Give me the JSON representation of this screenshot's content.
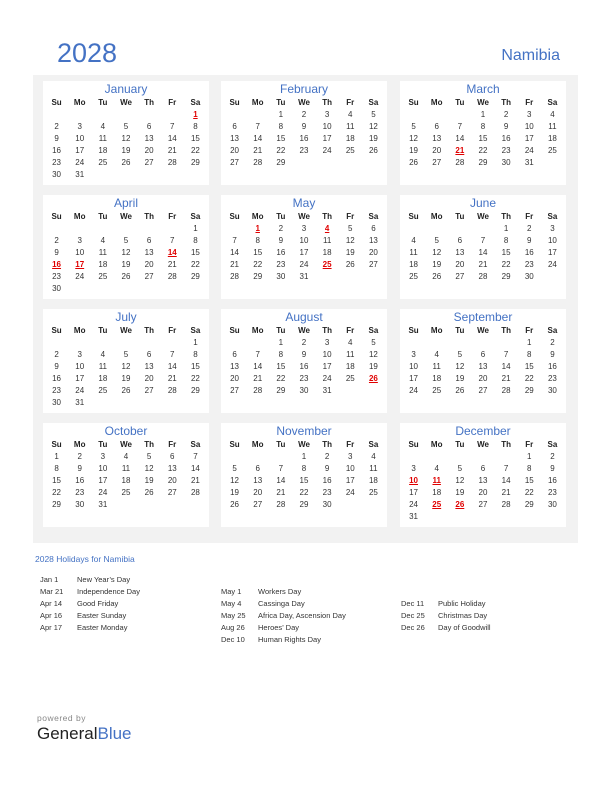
{
  "header": {
    "year": "2028",
    "country": "Namibia"
  },
  "weekdays": [
    "Su",
    "Mo",
    "Tu",
    "We",
    "Th",
    "Fr",
    "Sa"
  ],
  "months": [
    {
      "name": "January",
      "offset": 6,
      "days": 31,
      "holidays": [
        1
      ]
    },
    {
      "name": "February",
      "offset": 2,
      "days": 29,
      "holidays": []
    },
    {
      "name": "March",
      "offset": 3,
      "days": 31,
      "holidays": [
        21
      ]
    },
    {
      "name": "April",
      "offset": 6,
      "days": 30,
      "holidays": [
        14,
        16,
        17
      ]
    },
    {
      "name": "May",
      "offset": 1,
      "days": 31,
      "holidays": [
        1,
        4,
        25
      ]
    },
    {
      "name": "June",
      "offset": 4,
      "days": 30,
      "holidays": []
    },
    {
      "name": "July",
      "offset": 6,
      "days": 31,
      "holidays": []
    },
    {
      "name": "August",
      "offset": 2,
      "days": 31,
      "holidays": [
        26
      ]
    },
    {
      "name": "September",
      "offset": 5,
      "days": 30,
      "holidays": []
    },
    {
      "name": "October",
      "offset": 0,
      "days": 31,
      "holidays": []
    },
    {
      "name": "November",
      "offset": 3,
      "days": 30,
      "holidays": []
    },
    {
      "name": "December",
      "offset": 5,
      "days": 31,
      "holidays": [
        10,
        11,
        25,
        26
      ]
    }
  ],
  "holidays_title": "2028 Holidays for Namibia",
  "holiday_columns": [
    [
      {
        "date": "Jan 1",
        "name": "New Year’s Day"
      },
      {
        "date": "Mar 21",
        "name": "Independence Day"
      },
      {
        "date": "Apr 14",
        "name": "Good Friday"
      },
      {
        "date": "Apr 16",
        "name": "Easter Sunday"
      },
      {
        "date": "Apr 17",
        "name": "Easter Monday"
      }
    ],
    [
      {
        "date": "May 1",
        "name": "Workers Day"
      },
      {
        "date": "May 4",
        "name": "Cassinga Day"
      },
      {
        "date": "May 25",
        "name": "Africa Day, Ascension Day"
      },
      {
        "date": "Aug 26",
        "name": "Heroes’ Day"
      },
      {
        "date": "Dec 10",
        "name": "Human Rights Day"
      }
    ],
    [
      {
        "date": "Dec 11",
        "name": "Public Holiday"
      },
      {
        "date": "Dec 25",
        "name": "Christmas Day"
      },
      {
        "date": "Dec 26",
        "name": "Day of Goodwill"
      }
    ]
  ],
  "footer": {
    "powered": "powered by",
    "brand_a": "General",
    "brand_b": "Blue"
  }
}
